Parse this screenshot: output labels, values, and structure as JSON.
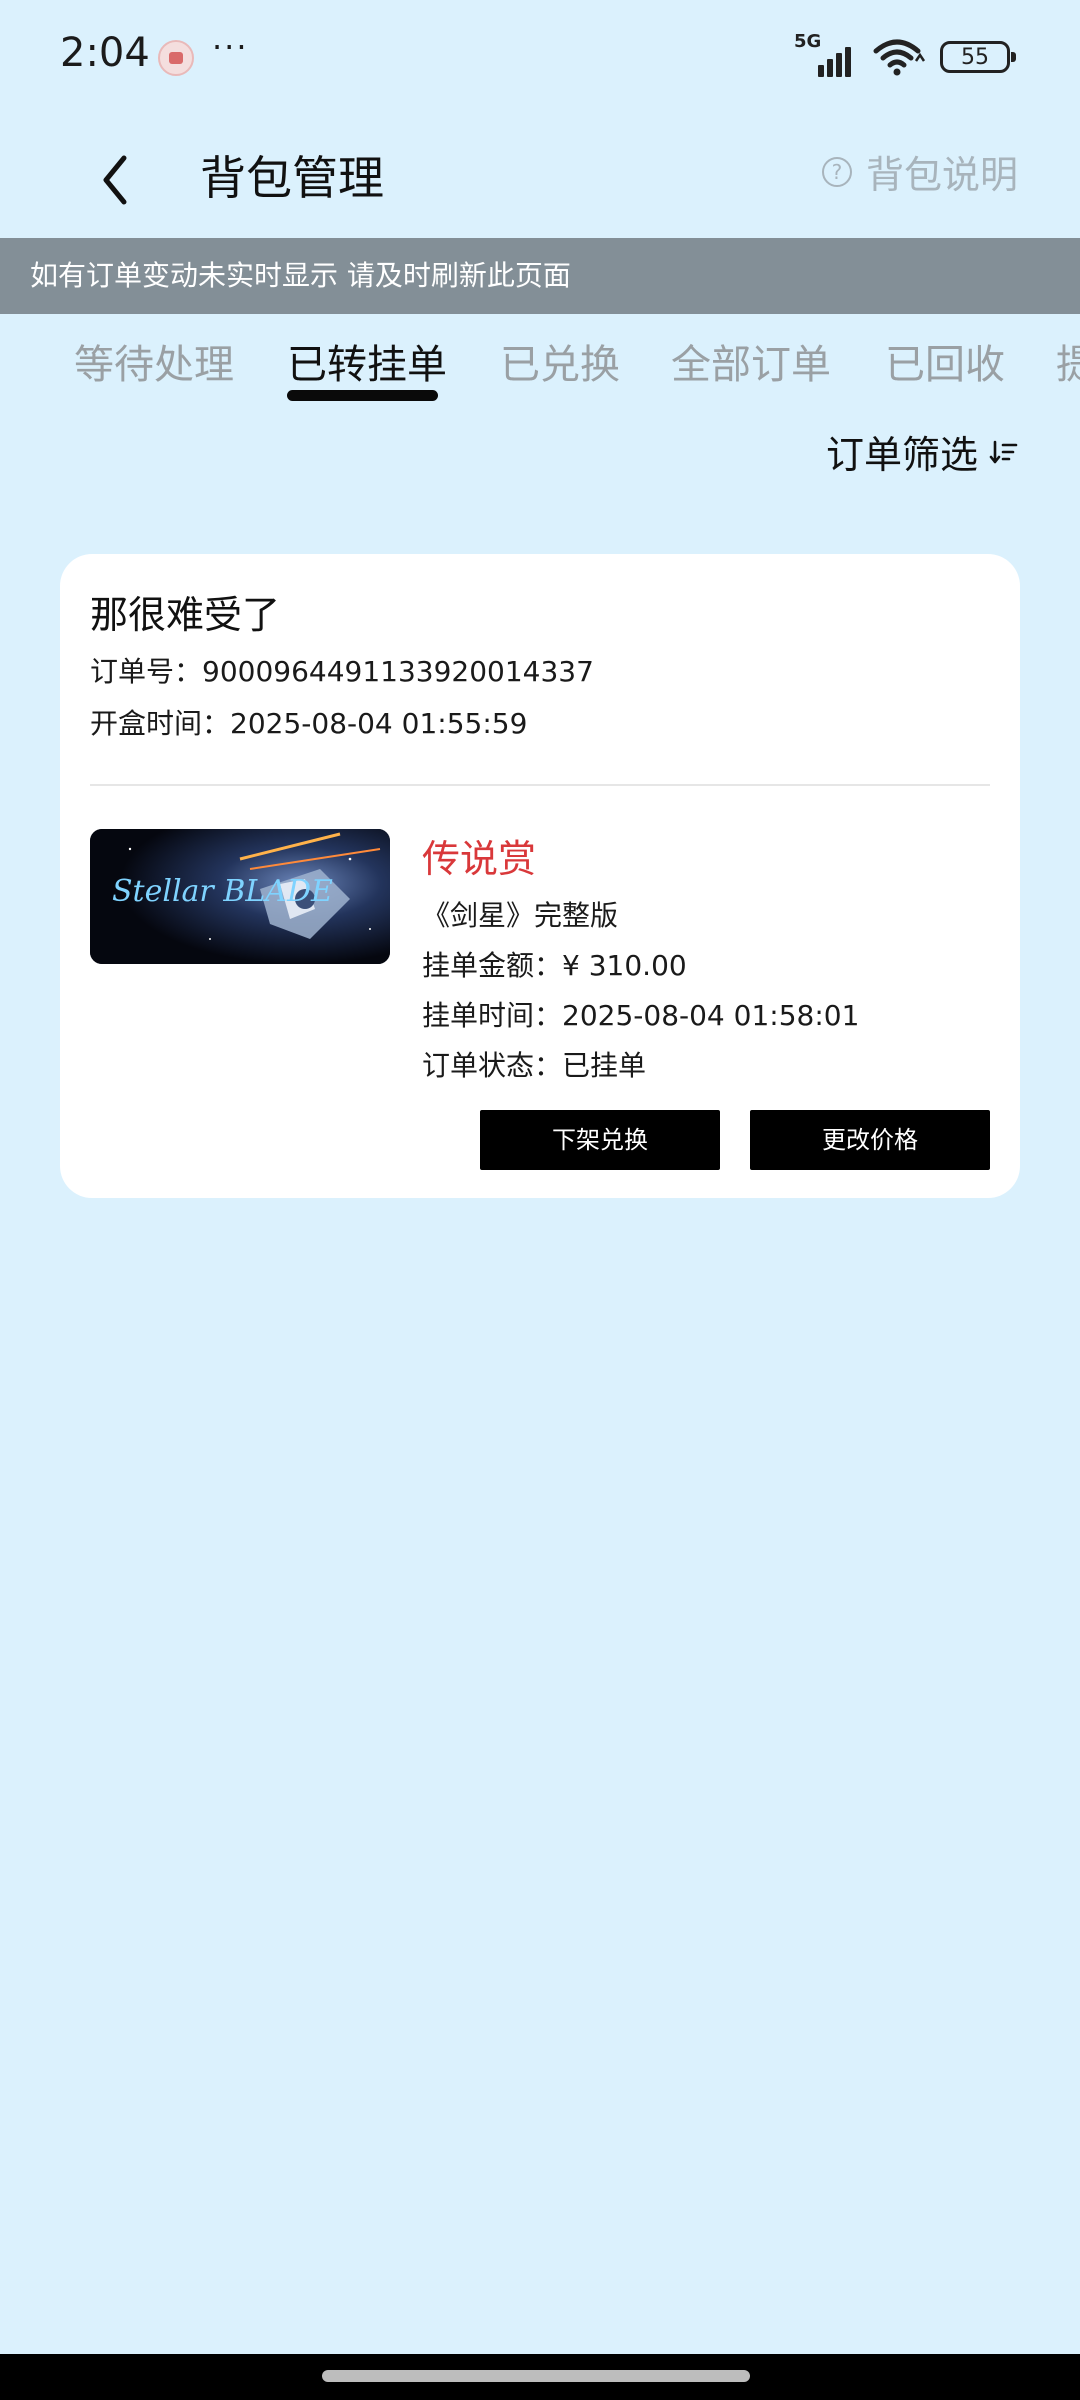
{
  "status_bar": {
    "time": "2:04",
    "more": "···",
    "network": "5G",
    "battery": "55"
  },
  "header": {
    "title": "背包管理",
    "help_label": "背包说明",
    "help_icon_glyph": "?"
  },
  "notice": "如有订单变动未实时显示 请及时刷新此页面",
  "tabs": [
    {
      "label": "等待处理"
    },
    {
      "label": "已转挂单"
    },
    {
      "label": "已兑换"
    },
    {
      "label": "全部订单"
    },
    {
      "label": "已回收"
    },
    {
      "label": "提"
    }
  ],
  "active_tab": "已转挂单",
  "filter": {
    "label": "订单筛选",
    "icon": "sort-icon"
  },
  "order": {
    "title": "那很难受了",
    "order_no_label": "订单号：",
    "order_no": "9000964491133920014337",
    "open_time_label": "开盒时间：",
    "open_time": "2025-08-04 01:55:59",
    "product_image_text": "Stellar BLADE",
    "prize_tier": "传说赏",
    "product_name": "《剑星》完整版",
    "price_label": "挂单金额：",
    "price": "¥ 310.00",
    "listing_time_label": "挂单时间：",
    "listing_time": "2025-08-04 01:58:01",
    "status_label": "订单状态：",
    "status": "已挂单",
    "buttons": {
      "delist": "下架兑换",
      "change_price": "更改价格"
    }
  },
  "colors": {
    "background": "#dbf1fd",
    "notice_bg": "#838f97",
    "prize_red": "#d9383a",
    "button_black": "#000000",
    "tab_inactive": "#9aa0a4"
  }
}
